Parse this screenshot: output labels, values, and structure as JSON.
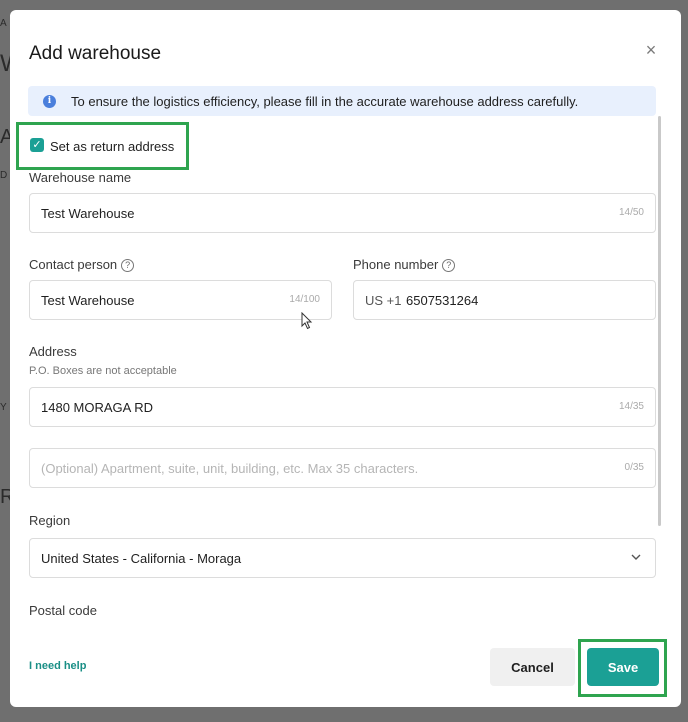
{
  "modal": {
    "title": "Add warehouse",
    "close_label": "×"
  },
  "banner": {
    "icon": "info-icon",
    "text": "To ensure the logistics efficiency, please fill in the accurate warehouse address carefully."
  },
  "return_address": {
    "label": "Set as return address",
    "checked": true
  },
  "warehouse_name": {
    "label": "Warehouse name",
    "value": "Test Warehouse",
    "count": "14/50"
  },
  "contact_person": {
    "label": "Contact person",
    "value": "Test Warehouse",
    "count": "14/100"
  },
  "phone_number": {
    "label": "Phone number",
    "prefix": "US +1",
    "value": "6507531264"
  },
  "address": {
    "label": "Address",
    "hint": "P.O. Boxes are not acceptable",
    "line1_value": "1480 MORAGA RD",
    "line1_count": "14/35",
    "line2_placeholder": "(Optional) Apartment, suite, unit, building, etc. Max 35 characters.",
    "line2_count": "0/35"
  },
  "region": {
    "label": "Region",
    "value": "United States - California - Moraga"
  },
  "postal_code": {
    "label": "Postal code"
  },
  "footer": {
    "help_link": "I need help",
    "cancel_label": "Cancel",
    "save_label": "Save"
  },
  "colors": {
    "accent": "#1ba095",
    "highlight_border": "#2ea44f",
    "banner_bg": "#e8f0fd"
  }
}
